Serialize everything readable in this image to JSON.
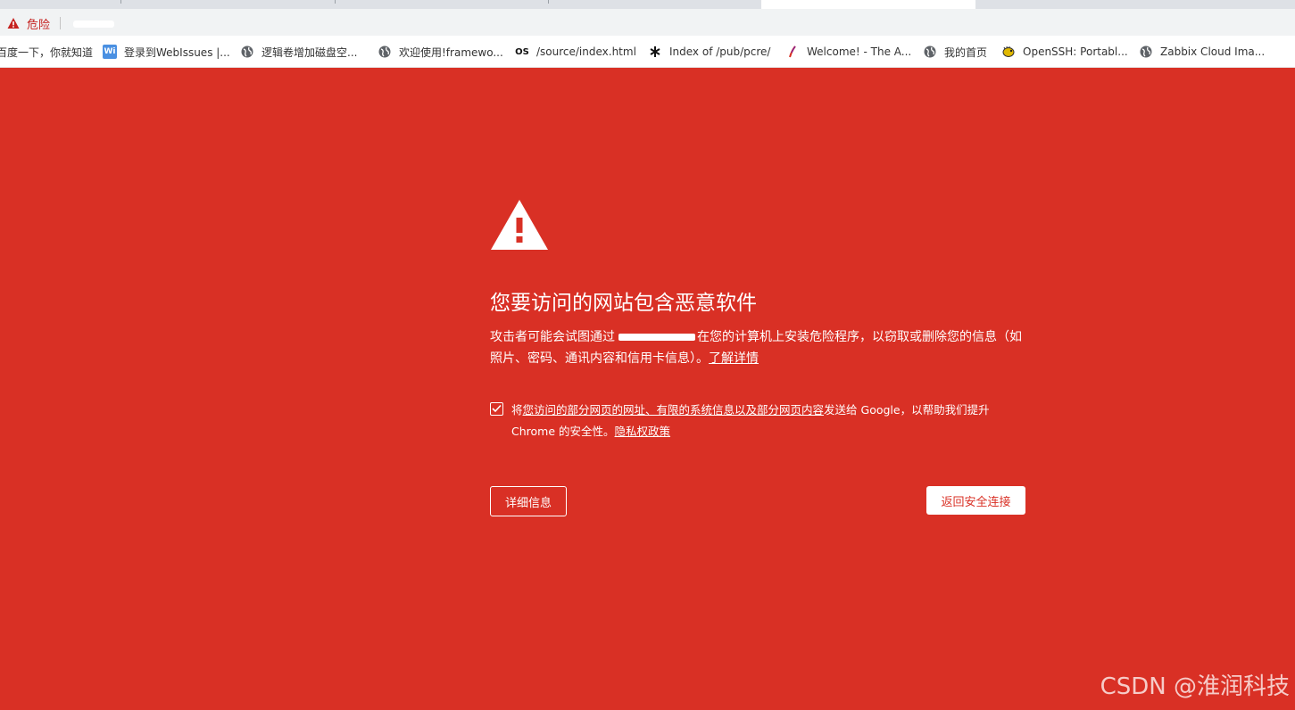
{
  "omnibox": {
    "security_label": "危险"
  },
  "bookmarks": [
    {
      "label": "百度一下，你就知道",
      "icon": "baidu-icon"
    },
    {
      "label": "登录到WebIssues |...",
      "icon": "webissues-icon"
    },
    {
      "label": "逻辑卷增加磁盘空...",
      "icon": "globe-icon"
    },
    {
      "label": "欢迎使用!framewo...",
      "icon": "globe-icon"
    },
    {
      "label": "/source/index.html",
      "icon": "os-icon"
    },
    {
      "label": "Index of /pub/pcre/",
      "icon": "asterisk-icon"
    },
    {
      "label": "Welcome! - The A...",
      "icon": "feather-icon"
    },
    {
      "label": "我的首页",
      "icon": "globe-icon"
    },
    {
      "label": "OpenSSH: Portabl...",
      "icon": "puffer-icon"
    },
    {
      "label": "Zabbix Cloud Ima...",
      "icon": "globe-icon"
    }
  ],
  "interstitial": {
    "heading": "您要访问的网站包含恶意软件",
    "desc_before": "攻击者可能会试图通过",
    "desc_after": "在您的计算机上安装危险程序，以窃取或删除您的信息（如照片、密码、通讯内容和信用卡信息）。",
    "learn_more": "了解详情",
    "optin_prefix": "将",
    "optin_link": "您访问的部分网页的网址、有限的系统信息以及部分网页内容",
    "optin_suffix": "发送给 Google，以帮助我们提升 Chrome 的安全性。",
    "privacy_link": "隐私权政策",
    "optin_checked": true,
    "details_button": "详细信息",
    "back_button": "返回安全连接"
  },
  "colors": {
    "background": "#d93025",
    "danger_text": "#c5221f"
  },
  "watermark": "CSDN @淮润科技"
}
